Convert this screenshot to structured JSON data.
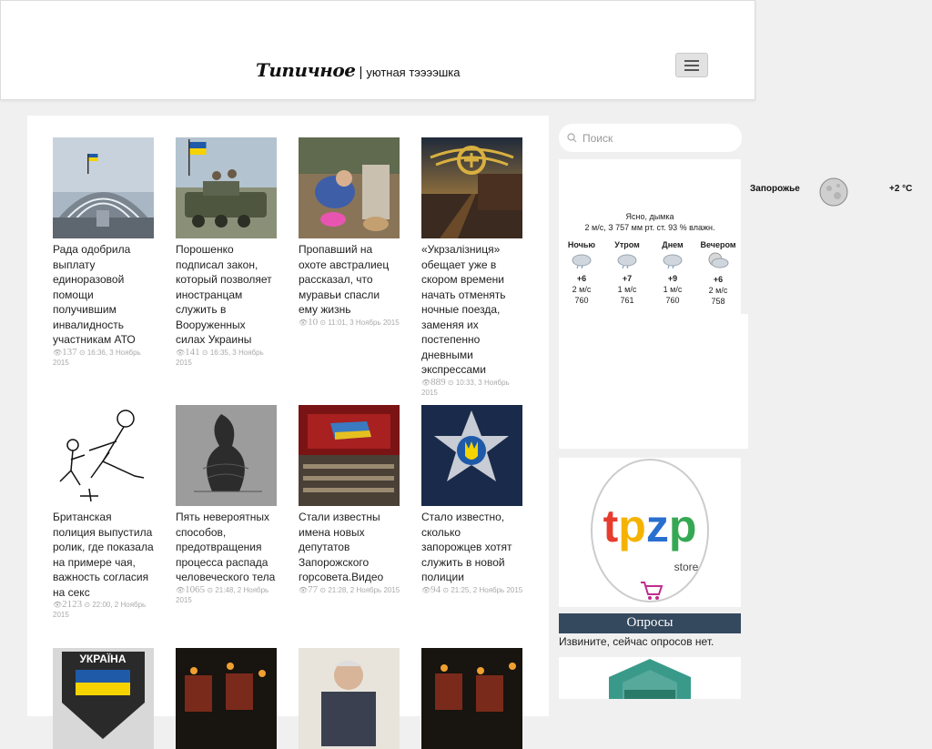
{
  "header": {
    "logo_main": "Типичное",
    "logo_sep": "|",
    "logo_tagline": "уютная тээээшка"
  },
  "search": {
    "placeholder": "Поиск"
  },
  "weather": {
    "city": "Запорожье",
    "temp_now": "+2 °C",
    "description": "Ясно, дымка",
    "stats": "2 м/с, З   757 мм рт. ст.   93 % влажн.",
    "periods": [
      {
        "name": "Ночью",
        "temp": "+6",
        "wind": "2 м/с",
        "pressure": "760",
        "icon": "cloud-rain-icon"
      },
      {
        "name": "Утром",
        "temp": "+7",
        "wind": "1 м/с",
        "pressure": "761",
        "icon": "cloud-rain-icon"
      },
      {
        "name": "Днем",
        "temp": "+9",
        "wind": "1 м/с",
        "pressure": "760",
        "icon": "cloud-rain-icon"
      },
      {
        "name": "Вечером",
        "temp": "+6",
        "wind": "2 м/с",
        "pressure": "758",
        "icon": "moon-cloud-icon"
      }
    ]
  },
  "ad": {
    "brand": "tpzp",
    "sub": "store"
  },
  "polls": {
    "heading": "Опросы",
    "text": "Извините, сейчас опросов нет."
  },
  "articles": [
    {
      "title": "Рада одобрила выплату единоразовой помощи получившим инвалидность участникам АТО",
      "views": "137",
      "time": "16:36, 3 Ноябрь 2015"
    },
    {
      "title": "Порошенко подписал закон, который позволяет иностранцам служить в Вооруженных силах Украины",
      "views": "141",
      "time": "16:35, 3 Ноябрь 2015"
    },
    {
      "title": "Пропавший на охоте австралиец рассказал, что муравьи спасли ему жизнь",
      "views": "10",
      "time": "11:01, 3 Ноябрь 2015"
    },
    {
      "title": "«Укрзалізниця» обещает уже в скором времени начать отменять ночные поезда, заменяя их постепенно дневными экспрессами",
      "views": "889",
      "time": "10:33, 3 Ноябрь 2015"
    },
    {
      "title": "Британская полиция выпустила ролик, где показала на примере чая, важность согласия на секс",
      "views": "2123",
      "time": "22:00, 2 Ноябрь 2015"
    },
    {
      "title": "Пять невероятных способов, предотвращения процесса распада человеческого тела",
      "views": "1065",
      "time": "21:48, 2 Ноябрь 2015"
    },
    {
      "title": "Стали известны имена новых депутатов Запорожского горсовета.Видео",
      "views": "77",
      "time": "21:28, 2 Ноябрь 2015"
    },
    {
      "title": "Стало известно, сколько запорожцев хотят служить в новой полиции",
      "views": "94",
      "time": "21:25, 2 Ноябрь 2015"
    }
  ],
  "row3": [
    {
      "badge": "УКРАЇНА"
    }
  ]
}
